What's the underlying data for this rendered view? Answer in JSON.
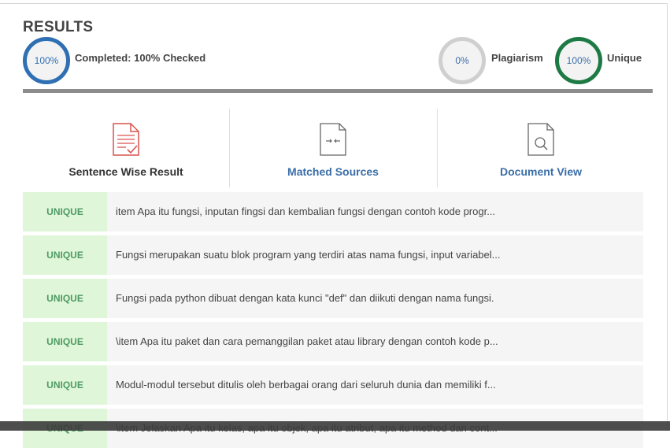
{
  "results": {
    "title": "RESULTS",
    "completed_percent": "100%",
    "completed_label": "Completed: 100% Checked",
    "plagiarism_percent": "0%",
    "plagiarism_label": "Plagiarism",
    "unique_percent": "100%",
    "unique_label": "Unique"
  },
  "tools": [
    {
      "label": "Sentence Wise Result",
      "icon": "document-check-icon",
      "color": "#333333"
    },
    {
      "label": "Matched Sources",
      "icon": "document-compare-icon",
      "color": "#3a6ea8"
    },
    {
      "label": "Document View",
      "icon": "document-search-icon",
      "color": "#3a6ea8"
    }
  ],
  "sentences": [
    {
      "status": "UNIQUE",
      "text": "item Apa itu fungsi, inputan fingsi dan kembalian fungsi dengan contoh kode progr..."
    },
    {
      "status": "UNIQUE",
      "text": "Fungsi merupakan suatu blok program yang terdiri atas nama fungsi, input variabel..."
    },
    {
      "status": "UNIQUE",
      "text": "Fungsi pada python dibuat dengan kata kunci \"def\" dan diikuti dengan nama fungsi."
    },
    {
      "status": "UNIQUE",
      "text": "\\item Apa itu paket dan cara pemanggilan paket atau library dengan contoh kode p..."
    },
    {
      "status": "UNIQUE",
      "text": "Modul-modul tersebut ditulis oleh berbagai orang dari seluruh dunia dan memiliki f..."
    },
    {
      "status": "UNIQUE",
      "text": "\\item Jelaskan Apa itu kelas, apa itu objek, apa itu atribut, apa itu method dan cont..."
    }
  ],
  "colors": {
    "accent_blue": "#2f6fb3",
    "unique_green": "#1e7a44",
    "tag_bg": "#dff7d8",
    "tag_text": "#4e9a63"
  }
}
